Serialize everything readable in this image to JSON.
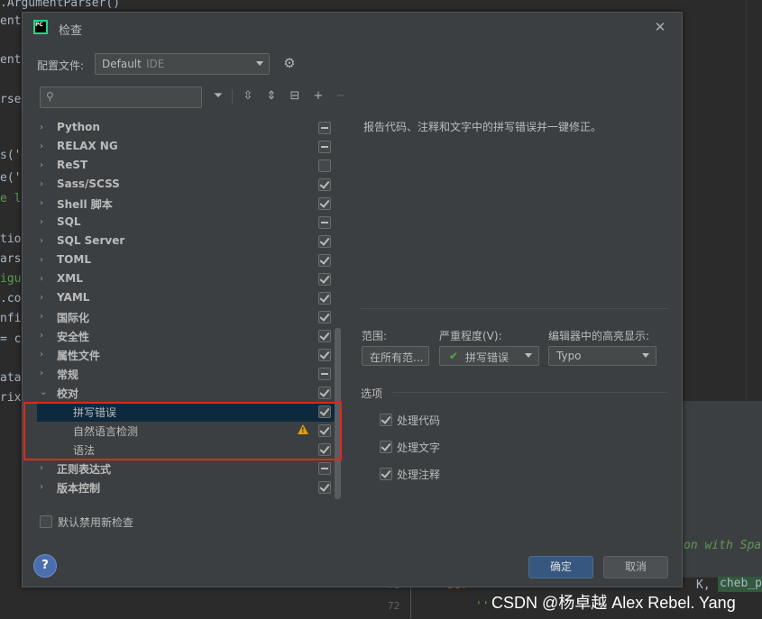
{
  "background_editor": {
    "left_fragments": [
      ".ArgumentParser()",
      "ent",
      "ent",
      "rse_",
      "s('",
      "e('",
      "e lo",
      "tion",
      "arse",
      "igu",
      ".co",
      "nfi",
      "= co",
      "ata_",
      "rix"
    ],
    "italic_comment": "on with Spa",
    "def_keyword": "def",
    "def_tail": "K,",
    "def_param": "cheb_p",
    "doc_quote": "'''",
    "gutter_numbers": [
      "71",
      "72"
    ],
    "watermark": "CSDN @杨卓越 Alex Rebel. Yang"
  },
  "dialog": {
    "title": "检查",
    "close_icon": "close-icon",
    "profile_label": "配置文件:",
    "profile_value": "Default",
    "profile_scope": "IDE",
    "search_placeholder": "",
    "tree": [
      {
        "label": "Python",
        "state": "partial",
        "level": 0,
        "expanded": false
      },
      {
        "label": "RELAX NG",
        "state": "partial",
        "level": 0,
        "expanded": false
      },
      {
        "label": "ReST",
        "state": "unchecked",
        "level": 0,
        "expanded": false
      },
      {
        "label": "Sass/SCSS",
        "state": "checked",
        "level": 0,
        "expanded": false
      },
      {
        "label": "Shell 脚本",
        "state": "checked",
        "level": 0,
        "expanded": false
      },
      {
        "label": "SQL",
        "state": "partial",
        "level": 0,
        "expanded": false
      },
      {
        "label": "SQL Server",
        "state": "checked",
        "level": 0,
        "expanded": false
      },
      {
        "label": "TOML",
        "state": "checked",
        "level": 0,
        "expanded": false
      },
      {
        "label": "XML",
        "state": "checked",
        "level": 0,
        "expanded": false
      },
      {
        "label": "YAML",
        "state": "checked",
        "level": 0,
        "expanded": false
      },
      {
        "label": "国际化",
        "state": "checked",
        "level": 0,
        "expanded": false
      },
      {
        "label": "安全性",
        "state": "checked",
        "level": 0,
        "expanded": false
      },
      {
        "label": "属性文件",
        "state": "checked",
        "level": 0,
        "expanded": false
      },
      {
        "label": "常规",
        "state": "partial",
        "level": 0,
        "expanded": false
      },
      {
        "label": "校对",
        "state": "checked",
        "level": 0,
        "expanded": true
      },
      {
        "label": "拼写错误",
        "state": "checked",
        "level": 1,
        "selected": true
      },
      {
        "label": "自然语言检测",
        "state": "checked",
        "level": 1,
        "warning": true
      },
      {
        "label": "语法",
        "state": "checked",
        "level": 1
      },
      {
        "label": "正则表达式",
        "state": "partial",
        "level": 0,
        "expanded": false
      },
      {
        "label": "版本控制",
        "state": "checked",
        "level": 0,
        "expanded": false
      }
    ],
    "disable_new_label": "默认禁用新检查",
    "description": "报告代码、注释和文字中的拼写错误并一键修正。",
    "scope_label": "范围:",
    "scope_value": "在所有范...",
    "severity_label": "严重程度(V):",
    "severity_value": "拼写错误",
    "highlight_label": "编辑器中的高亮显示:",
    "highlight_value": "Typo",
    "options_title": "选项",
    "options": [
      "处理代码",
      "处理文字",
      "处理注释"
    ],
    "help_label": "?",
    "ok_label": "确定",
    "cancel_label": "取消"
  },
  "colors": {
    "accent_blue": "#365880",
    "selection": "#0d293e",
    "highlight_red": "#e0271c",
    "warning": "#e0a000",
    "typo_green": "#4faf3e"
  }
}
